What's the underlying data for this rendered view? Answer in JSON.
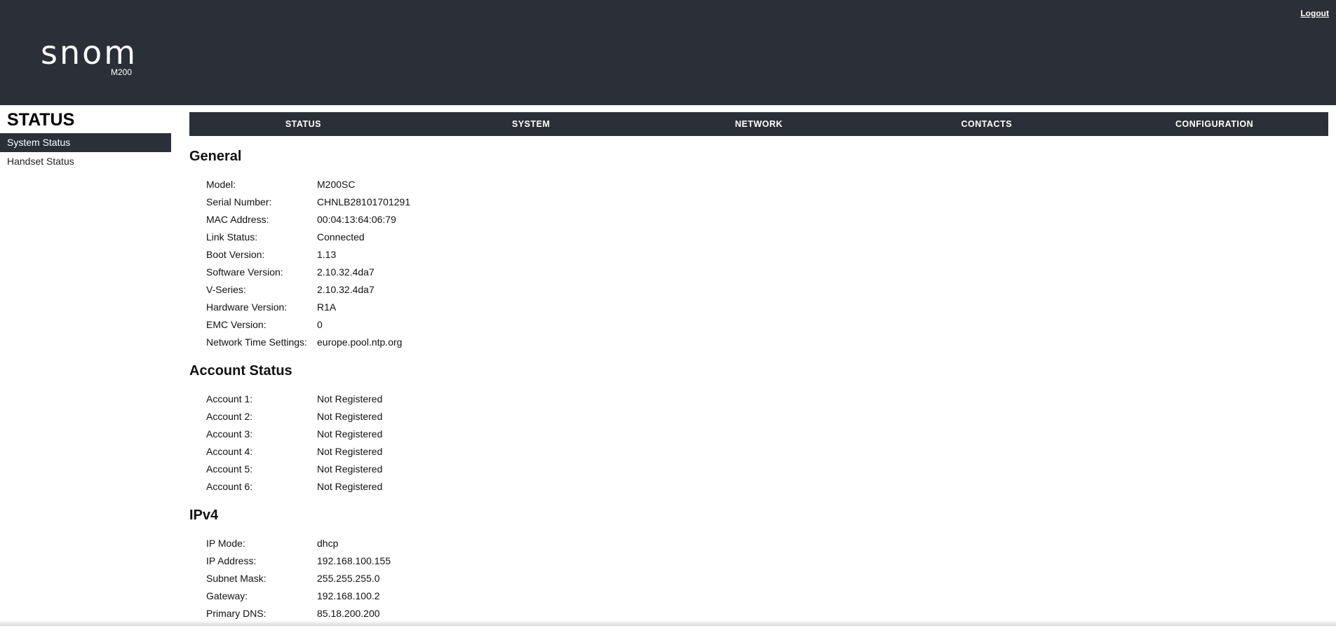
{
  "header": {
    "logo_text": "snom",
    "model": "M200",
    "logout_label": "Logout"
  },
  "sidebar": {
    "title": "STATUS",
    "items": [
      {
        "label": "System Status",
        "active": true
      },
      {
        "label": "Handset Status",
        "active": false
      }
    ]
  },
  "nav": {
    "items": [
      "STATUS",
      "SYSTEM",
      "NETWORK",
      "CONTACTS",
      "CONFIGURATION"
    ]
  },
  "general": {
    "title": "General",
    "rows": [
      {
        "key": "Model:",
        "value": "M200SC"
      },
      {
        "key": "Serial Number:",
        "value": "CHNLB28101701291"
      },
      {
        "key": "MAC Address:",
        "value": "00:04:13:64:06:79"
      },
      {
        "key": "Link Status:",
        "value": "Connected"
      },
      {
        "key": "Boot Version:",
        "value": "1.13"
      },
      {
        "key": "Software Version:",
        "value": "2.10.32.4da7"
      },
      {
        "key": "V-Series:",
        "value": "2.10.32.4da7"
      },
      {
        "key": "Hardware Version:",
        "value": "R1A"
      },
      {
        "key": "EMC Version:",
        "value": "0"
      },
      {
        "key": "Network Time Settings:",
        "value": "europe.pool.ntp.org"
      }
    ]
  },
  "account_status": {
    "title": "Account Status",
    "rows": [
      {
        "key": "Account 1:",
        "value": "Not Registered"
      },
      {
        "key": "Account 2:",
        "value": "Not Registered"
      },
      {
        "key": "Account 3:",
        "value": "Not Registered"
      },
      {
        "key": "Account 4:",
        "value": "Not Registered"
      },
      {
        "key": "Account 5:",
        "value": "Not Registered"
      },
      {
        "key": "Account 6:",
        "value": "Not Registered"
      }
    ]
  },
  "ipv4": {
    "title": "IPv4",
    "rows": [
      {
        "key": "IP Mode:",
        "value": "dhcp"
      },
      {
        "key": "IP Address:",
        "value": "192.168.100.155"
      },
      {
        "key": "Subnet Mask:",
        "value": "255.255.255.0"
      },
      {
        "key": "Gateway:",
        "value": "192.168.100.2"
      },
      {
        "key": "Primary DNS:",
        "value": "85.18.200.200"
      }
    ]
  },
  "colors": {
    "header_bg": "#2b3038",
    "text": "#111111"
  }
}
